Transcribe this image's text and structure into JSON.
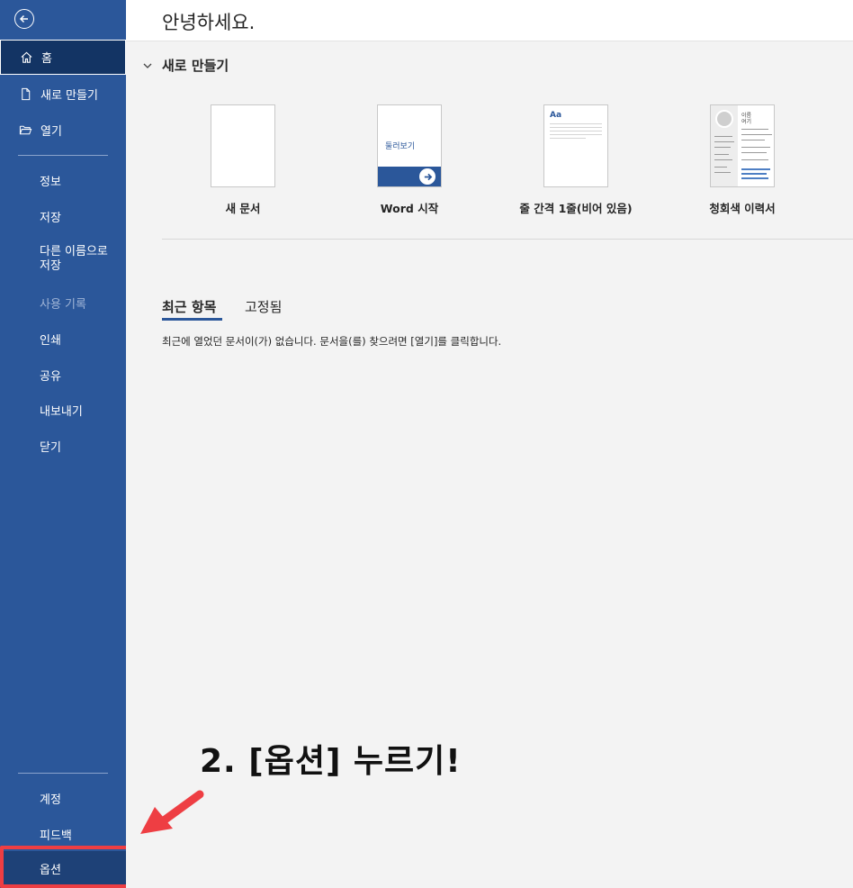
{
  "sidebar": {
    "back_icon": "back-arrow-circle-icon",
    "items": [
      {
        "label": "홈",
        "icon": "home-icon"
      },
      {
        "label": "새로 만들기",
        "icon": "new-document-icon"
      },
      {
        "label": "열기",
        "icon": "open-folder-icon"
      },
      {
        "label": "정보"
      },
      {
        "label": "저장"
      },
      {
        "label": "다른 이름으로\n저장"
      },
      {
        "label": "사용 기록"
      },
      {
        "label": "인쇄"
      },
      {
        "label": "공유"
      },
      {
        "label": "내보내기"
      },
      {
        "label": "닫기"
      },
      {
        "label": "계정"
      },
      {
        "label": "피드백"
      },
      {
        "label": "옵션"
      }
    ]
  },
  "main": {
    "greeting": "안녕하세요.",
    "new_section_title": "새로 만들기",
    "templates": [
      {
        "label": "새 문서"
      },
      {
        "label": "Word 시작",
        "thumb_text": "둘러보기"
      },
      {
        "label": "줄 간격 1줄(비어 있음)",
        "thumb_text": "Aa"
      },
      {
        "label": "청회색 이력서",
        "thumb_text": "이름\n여기"
      }
    ],
    "tabs": [
      {
        "label": "최근 항목"
      },
      {
        "label": "고정됨"
      }
    ],
    "empty_message": "최근에 열었던 문서이(가) 없습니다. 문서을(를) 찾으려면 [열기]를 클릭합니다."
  },
  "annotation": {
    "callout": "2. [옵션] 누르기!",
    "arrow_color": "#ee3e43",
    "highlight_color": "#ee3e43"
  },
  "colors": {
    "sidebar_bg": "#2b579a",
    "active_bg": "#133464",
    "main_bg": "#f3f3f3"
  }
}
